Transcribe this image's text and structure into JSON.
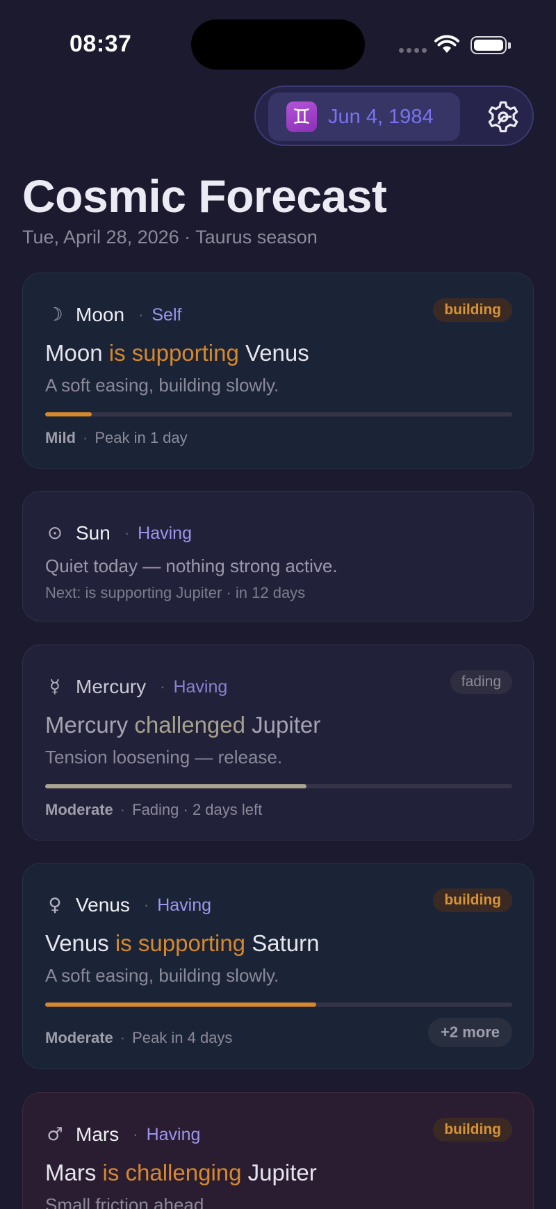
{
  "status_bar": {
    "time": "08:37"
  },
  "header": {
    "zodiac_icon": "gemini-icon",
    "zodiac_glyph": "♊",
    "birth_date": "Jun 4, 1984",
    "settings_icon": "gear-icon"
  },
  "page": {
    "title": "Cosmic Forecast",
    "subtitle": "Tue, April 28, 2026 · Taurus season"
  },
  "cards": [
    {
      "glyph": "☽",
      "planet": "Moon",
      "house": "Self",
      "badge": "building",
      "aspect_subject": "Moon",
      "aspect_verb": "is supporting",
      "aspect_target": "Venus",
      "description": "A soft easing, building slowly.",
      "progress": 0.1,
      "intensity": "Mild",
      "timing": "Peak in 1 day"
    },
    {
      "glyph": "⊙",
      "planet": "Sun",
      "house": "Having",
      "quiet_text": "Quiet today — nothing strong active.",
      "next_text": "Next: is supporting Jupiter · in 12 days"
    },
    {
      "glyph": "☿",
      "planet": "Mercury",
      "house": "Having",
      "badge": "fading",
      "aspect_subject": "Mercury",
      "aspect_verb": "challenged",
      "aspect_target": "Jupiter",
      "description": "Tension loosening — release.",
      "progress": 0.56,
      "intensity": "Moderate",
      "timing": "Fading · 2 days left"
    },
    {
      "glyph": "♀",
      "planet": "Venus",
      "house": "Having",
      "badge": "building",
      "aspect_subject": "Venus",
      "aspect_verb": "is supporting",
      "aspect_target": "Saturn",
      "description": "A soft easing, building slowly.",
      "progress": 0.58,
      "intensity": "Moderate",
      "timing": "Peak in 4 days",
      "more_label": "+2 more"
    },
    {
      "glyph": "♂",
      "planet": "Mars",
      "house": "Having",
      "badge": "building",
      "aspect_subject": "Mars",
      "aspect_verb": "is challenging",
      "aspect_target": "Jupiter",
      "description": "Small friction ahead."
    }
  ],
  "colors": {
    "background": "#1c1a2e",
    "accent_orange": "#d6882c",
    "accent_purple": "#9d95ee",
    "chip_date": "#7b72f0"
  }
}
